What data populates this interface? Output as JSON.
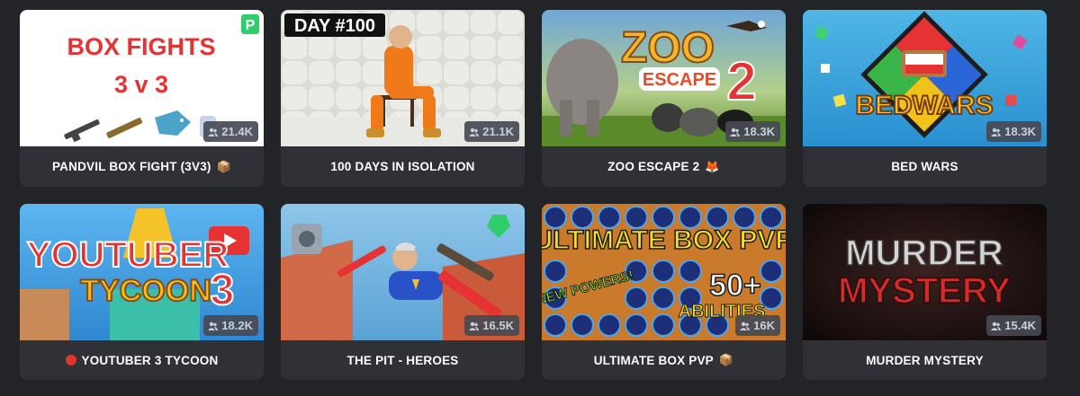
{
  "cards": [
    {
      "title": "PANDVIL BOX FIGHT (3V3)",
      "suffix_emoji": "📦",
      "players": "21.4K",
      "art_text": [
        "BOX FIGHTS",
        "3 v 3"
      ],
      "logo": "P"
    },
    {
      "title": "100 DAYS IN ISOLATION",
      "players": "21.1K",
      "art_text": [
        "DAY #100"
      ]
    },
    {
      "title": "ZOO ESCAPE 2",
      "suffix_emoji": "🦊",
      "players": "18.3K",
      "art_text": [
        "ZOO",
        "ESCAPE",
        "2"
      ]
    },
    {
      "title": "BED WARS",
      "players": "18.3K",
      "art_text": [
        "BEDWARS"
      ]
    },
    {
      "title": "YOUTUBER 3 TYCOON",
      "prefix_icon": "red-circle-icon",
      "players": "18.2K",
      "art_text": [
        "YOUTUBER",
        "TYCOON",
        "3"
      ]
    },
    {
      "title": "THE PIT - HEROES",
      "players": "16.5K",
      "art_text": []
    },
    {
      "title": "ULTIMATE BOX PVP",
      "suffix_emoji": "📦",
      "players": "16K",
      "art_text": [
        "ULTIMATE BOX PVP",
        "NEW POWERS!",
        "50+",
        "ABILITIES"
      ]
    },
    {
      "title": "MURDER MYSTERY",
      "players": "15.4K",
      "art_text": [
        "MURDER",
        "MYSTERY"
      ]
    }
  ],
  "colors": {
    "page_bg": "#232428",
    "card_bg": "#2f3136",
    "badge_bg": "#464a52",
    "badge_text": "#c9d0dc"
  }
}
